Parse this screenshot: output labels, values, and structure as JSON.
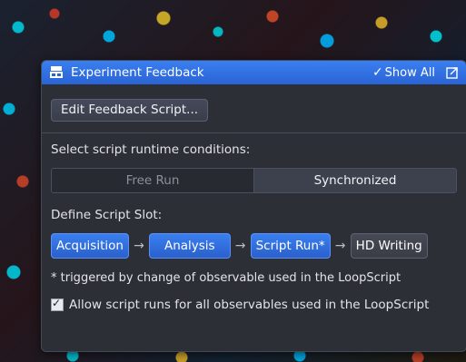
{
  "window": {
    "title": "Experiment Feedback",
    "show_all_label": "Show All"
  },
  "edit_button": {
    "label": "Edit Feedback Script..."
  },
  "runtime": {
    "label": "Select script runtime conditions:",
    "options": [
      "Free Run",
      "Synchronized"
    ],
    "selected": "Synchronized"
  },
  "slot_section": {
    "label": "Define Script Slot:",
    "slots": [
      {
        "label": "Acquisition",
        "active": true
      },
      {
        "label": "Analysis",
        "active": true
      },
      {
        "label": "Script Run*",
        "active": true
      },
      {
        "label": "HD Writing",
        "active": false
      }
    ],
    "arrow": "→"
  },
  "note": "* triggered by change of observable used in the LoopScript",
  "allow_checkbox": {
    "label": "Allow script runs for all observables used in the LoopScript",
    "checked": true
  },
  "colors": {
    "titlebar": "#3a7ff0",
    "panel": "#2c2f36",
    "accent": "#3a7ff0"
  }
}
